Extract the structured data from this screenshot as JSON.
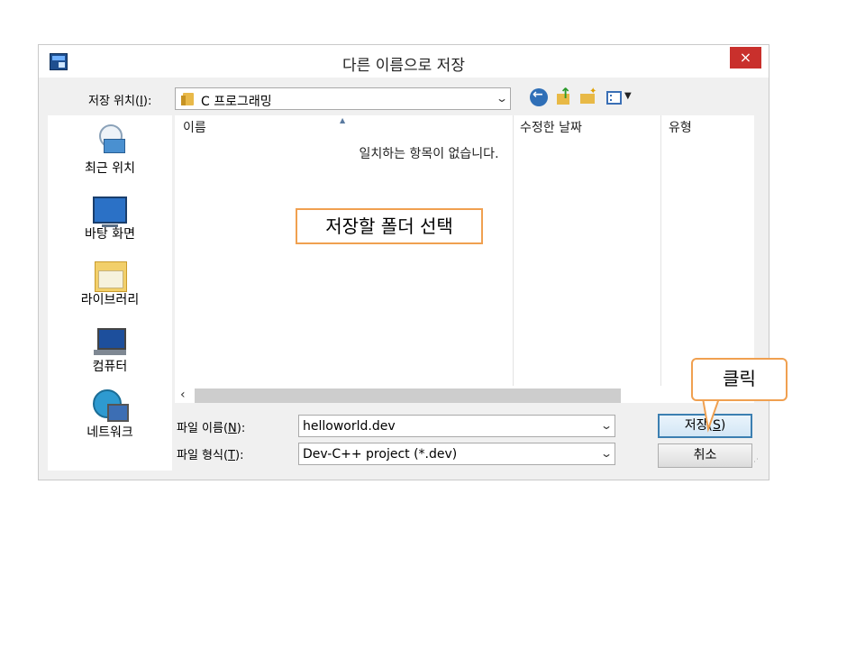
{
  "dialog": {
    "title": "다른 이름으로 저장",
    "close_glyph": "×"
  },
  "location": {
    "label_pre": "저장 위치(",
    "label_key": "I",
    "label_post": "):",
    "value": "C 프로그래밍"
  },
  "toolbar_icons": [
    "back-icon",
    "up-folder-icon",
    "new-folder-icon",
    "view-menu-icon"
  ],
  "places": [
    {
      "label": "최근 위치",
      "icon": "recent-places-icon"
    },
    {
      "label": "바탕 화면",
      "icon": "desktop-icon"
    },
    {
      "label": "라이브러리",
      "icon": "library-icon"
    },
    {
      "label": "컴퓨터",
      "icon": "computer-icon"
    },
    {
      "label": "네트워크",
      "icon": "network-icon"
    }
  ],
  "filelist": {
    "columns": [
      "이름",
      "수정한 날짜",
      "유형"
    ],
    "empty_message": "일치하는 항목이 없습니다."
  },
  "filename": {
    "label_pre": "파일 이름(",
    "label_key": "N",
    "label_post": "):",
    "value": "helloworld.dev"
  },
  "filetype": {
    "label_pre": "파일 형식(",
    "label_key": "T",
    "label_post": "):",
    "value": "Dev-C++ project (*.dev)"
  },
  "buttons": {
    "save_pre": "저장(",
    "save_key": "S",
    "save_post": ")",
    "cancel": "취소"
  },
  "annotations": {
    "folder_callout": "저장할 폴더 선택",
    "click_bubble": "클릭"
  },
  "colors": {
    "close_button": "#c9302c",
    "callout_border": "#f0a050",
    "save_button_border": "#3c7fb1"
  }
}
